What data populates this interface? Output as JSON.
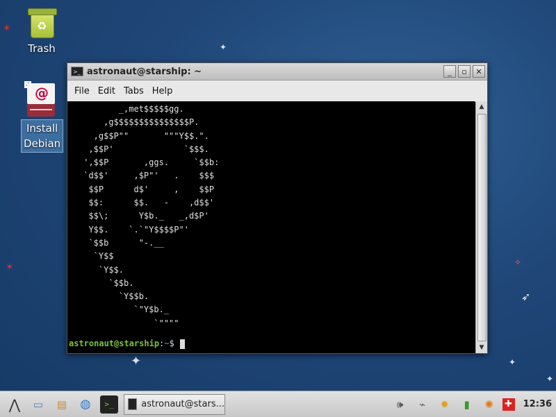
{
  "desktop": {
    "icons": [
      {
        "label": "Trash",
        "icon": "trash-icon"
      },
      {
        "label": "Install\nDebian",
        "icon": "debian-installer-icon"
      }
    ]
  },
  "window": {
    "title": "astronaut@starship: ~",
    "buttons": {
      "minimize": "_",
      "maximize": "▫",
      "close": "✕"
    },
    "menu": [
      "File",
      "Edit",
      "Tabs",
      "Help"
    ]
  },
  "terminal": {
    "ascii_art": "        _,met$$$$$gg.\n     ,g$$$$$$$$$$$$$$$P.\n   ,g$$P\"\"       \"\"\"Y$$.\".\n  ,$$P'              `$$$.\n ',$$P       ,ggs.     `$$b:\n `d$$'     ,$P\"'   .    $$$\n  $$P      d$'     ,    $$P\n  $$:      $$.   -    ,d$$'\n  $$\\;      Y$b._   _,d$P'\n  Y$$.    `.`\"Y$$$$P\"'\n  `$$b      \"-.__\n   `Y$$\n    `Y$$.\n      `$$b.\n        `Y$$b.\n           `\"Y$b._\n               `\"\"\"\"",
    "prompt_user": "astronaut@starship",
    "prompt_sep": ":",
    "prompt_path": "~",
    "prompt_symbol": "$"
  },
  "taskbar": {
    "task_label": "astronaut@stars...",
    "clock": "12:36"
  }
}
